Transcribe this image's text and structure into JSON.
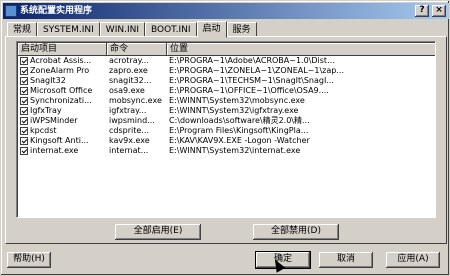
{
  "window": {
    "title": "系统配置实用程序",
    "controls": {
      "help": "?",
      "close": "×"
    }
  },
  "tabs": [
    {
      "label": "常规"
    },
    {
      "label": "SYSTEM.INI"
    },
    {
      "label": "WIN.INI"
    },
    {
      "label": "BOOT.INI"
    },
    {
      "label": "启动",
      "active": true
    },
    {
      "label": "服务"
    }
  ],
  "list": {
    "headers": {
      "item": "启动项目",
      "command": "命令",
      "location": "位置"
    },
    "rows": [
      {
        "item": "Acrobat Assis...",
        "command": "acrotray...",
        "location": "E:\\PROGRA~1\\Adobe\\ACROBA~1.0\\Dist...",
        "checked": true
      },
      {
        "item": "ZoneAlarm Pro",
        "command": "zapro.exe",
        "location": "E:\\PROGRA~1\\ZONELA~1\\ZONEAL~1\\zap...",
        "checked": true
      },
      {
        "item": "SnagIt32",
        "command": "snagit32...",
        "location": "E:\\PROGRA~1\\TECHSM~1\\SnagIt\\SnagI...",
        "checked": true
      },
      {
        "item": "Microsoft Office",
        "command": "osa9.exe",
        "location": "E:\\PROGRA~1\\OFFICE~1\\Office\\OSA9....",
        "checked": true
      },
      {
        "item": "Synchronizati...",
        "command": "mobsync.exe",
        "location": "E:\\WINNT\\System32\\mobsync.exe",
        "checked": true
      },
      {
        "item": "IgfxTray",
        "command": "igfxtray...",
        "location": "E:\\WINNT\\System32\\igfxtray.exe",
        "checked": true
      },
      {
        "item": "iWPSMinder",
        "command": "iwpsmind...",
        "location": "C:\\downloads\\software\\精灵2.0\\精...",
        "checked": true
      },
      {
        "item": "kpcdst",
        "command": "cdsprite...",
        "location": "E:\\Program Files\\Kingsoft\\KingPla...",
        "checked": true
      },
      {
        "item": "Kingsoft Anti...",
        "command": "kav9x.exe",
        "location": "E:\\KAV\\KAV9X.EXE -Logon -Watcher",
        "checked": true
      },
      {
        "item": "internat.exe",
        "command": "internat...",
        "location": "E:\\WINNT\\System32\\internat.exe",
        "checked": true
      }
    ]
  },
  "buttons": {
    "enable_all": "全部启用(E)",
    "disable_all": "全部禁用(D)",
    "help": "帮助(H)",
    "ok": "确定",
    "cancel": "取消",
    "apply": "应用(A)"
  }
}
